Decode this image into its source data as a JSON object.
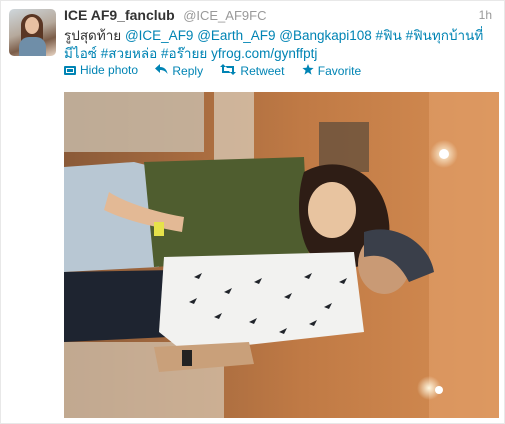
{
  "tweet": {
    "fullname": "ICE AF9_fanclub",
    "username": "@ICE_AF9FC",
    "time": "1h",
    "text": {
      "part1": "รูปสุดท้าย ",
      "mention1": "@ICE_AF9",
      "sp1": " ",
      "mention2": "@Earth_AF9",
      "sp2": " ",
      "mention3": "@Bangkapi108",
      "sp3": " ",
      "hashtag1": "#ฟิน",
      "sp4": " ",
      "hashtag2": "#ฟินทุกบ้านที่มีไอซ์",
      "sp5": " ",
      "hashtag3": "#สวยหล่อ",
      "sp6": " ",
      "hashtag4": "#อร๊ายย",
      "sp7": " ",
      "link": "yfrog.com/gynffptj"
    },
    "actions": {
      "hide_photo": "Hide photo",
      "reply": "Reply",
      "retweet": "Retweet",
      "favorite": "Favorite"
    },
    "icons": {
      "photo": "photo-icon",
      "reply": "reply-arrow-icon",
      "retweet": "retweet-icon",
      "favorite": "star-icon"
    },
    "colors": {
      "link": "#0084b4",
      "name": "#333333",
      "muted": "#999999"
    }
  }
}
